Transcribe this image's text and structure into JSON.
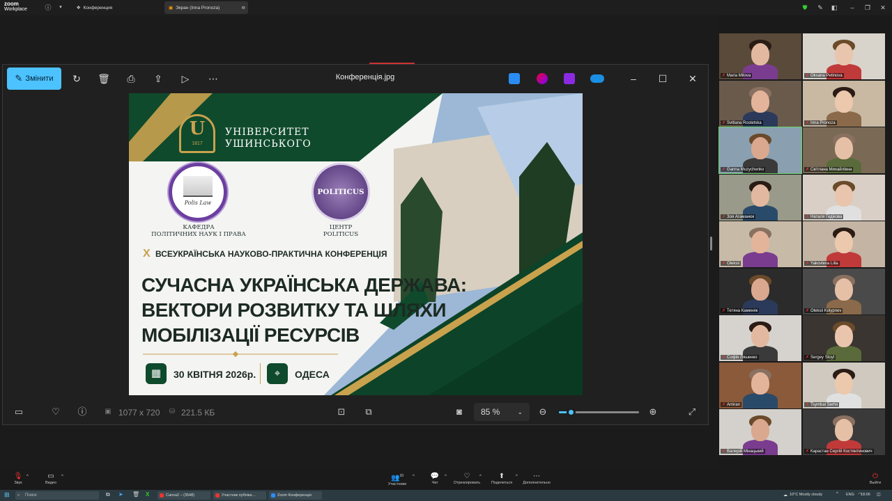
{
  "app": {
    "brand_line1": "zoom",
    "brand_line2": "Workplace"
  },
  "tabs": [
    {
      "label": "Конференция"
    },
    {
      "label": "Экран (Inna Pronoza)"
    }
  ],
  "viewer": {
    "edit_label": "Змінити",
    "title": "Конференція.jpg",
    "dimensions": "1077 x 720",
    "filesize": "221.5 КБ",
    "zoom_level": "85 %",
    "zoom_fraction": 0.15
  },
  "poster": {
    "university_line1": "УНІВЕРСИТЕТ",
    "university_line2": "УШИНСЬКОГО",
    "emblem_letter": "U",
    "emblem_year": "1817",
    "dept_line1": "КАФЕДРА",
    "dept_line2": "ПОЛІТИЧНИХ НАУК І ПРАВА",
    "dept_seal_text": "Polis Law",
    "center_seal_text": "POLITICUS",
    "center_line1": "ЦЕНТР",
    "center_line2": "POLITICUS",
    "conf_number": "X",
    "conf_type": "ВСЕУКРАЇНСЬКА НАУКОВО-ПРАКТИЧНА КОНФЕРЕНЦІЯ",
    "title_line1": "СУЧАСНА УКРАЇНСЬКА ДЕРЖАВА:",
    "title_line2": "ВЕКТОРИ РОЗВИТКУ ТА ШЛЯХИ",
    "title_line3": "МОБІЛІЗАЦІЇ РЕСУРСІВ",
    "date": "30 КВІТНЯ 2026р.",
    "city": "ОДЕСА"
  },
  "participants": [
    {
      "name": "Maria Milova"
    },
    {
      "name": "Oksana Petinova"
    },
    {
      "name": "Svitlana Rostetska"
    },
    {
      "name": "Inna Pronoza"
    },
    {
      "name": "Ganna Muzychenko"
    },
    {
      "name": "Світлана Михайлівна"
    },
    {
      "name": "Зоя Агаманюк"
    },
    {
      "name": "Наталя Гедікова"
    },
    {
      "name": "Oleksii"
    },
    {
      "name": "Yakovleva Lilia"
    },
    {
      "name": "Тетяна Каменяк"
    },
    {
      "name": "Oleksii Kolypnev"
    },
    {
      "name": "Софія Ляшенко"
    },
    {
      "name": "Sergey Stoyl"
    },
    {
      "name": "Amiran"
    },
    {
      "name": "Tsymbal Serhii"
    },
    {
      "name": "Валерій Мінацький"
    },
    {
      "name": "Карастан Сергій Костянтинович"
    }
  ],
  "controls": {
    "audio": "Звук",
    "video": "Видео",
    "participants": "Участники",
    "participants_count": "10",
    "chat": "Чат",
    "react": "Отреагировать",
    "share": "Поделиться",
    "more": "Дополнительно",
    "leave": "Выйти"
  },
  "taskbar": {
    "search": "Поиск",
    "apps": [
      {
        "label": "Canva2 – (3548)"
      },
      {
        "label": "Участник публіка…"
      },
      {
        "label": "Zoom Конференція"
      }
    ],
    "weather": "10°C  Mostly cloudy",
    "lang": "ENG",
    "time": "18:06"
  },
  "colors": {
    "accent": "#4cc2ff",
    "poster_green": "#0f4a2c",
    "poster_gold": "#c9a24e",
    "seal_purple": "#6b3fa0"
  }
}
